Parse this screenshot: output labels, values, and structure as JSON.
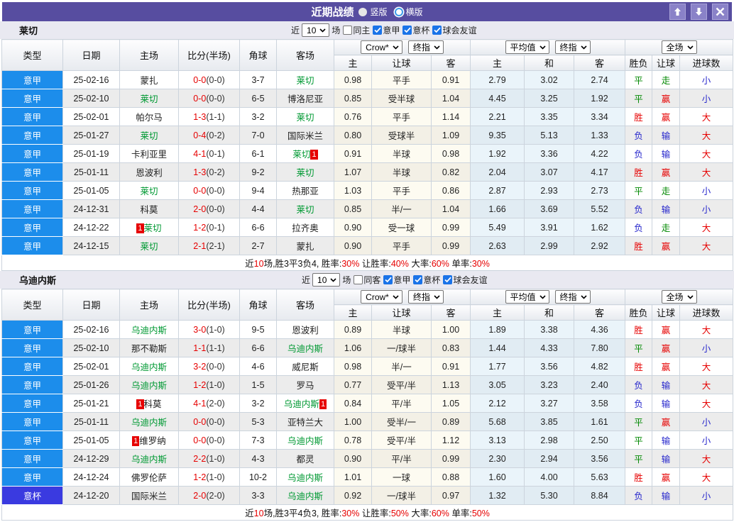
{
  "title_bar": {
    "title": "近期战绩",
    "radio_vertical": "竖版",
    "radio_horizontal": "横版"
  },
  "controls": {
    "near": "近",
    "games": "10",
    "games_suffix": "场",
    "leagues": [
      "意甲",
      "意杯",
      "球会友谊"
    ]
  },
  "columns": {
    "type": "类型",
    "date": "日期",
    "home": "主场",
    "score": "比分(半场)",
    "corner": "角球",
    "away": "客场",
    "odds_home": "主",
    "odds_handicap": "让球",
    "odds_away": "客",
    "avg_home": "主",
    "avg_draw": "和",
    "avg_away": "客",
    "result": "胜负",
    "handicap_result": "让球",
    "goals": "进球数"
  },
  "dropdowns": {
    "bookmaker": "Crow*",
    "final1": "终指",
    "average": "平均值",
    "final2": "终指",
    "fulltime": "全场"
  },
  "tables": [
    {
      "team": "莱切",
      "same_venue_label": "同主",
      "rows": [
        {
          "league": "意甲",
          "date": "25-02-16",
          "home": "蒙扎",
          "home_rc": "",
          "home_self": false,
          "ft": "0-0",
          "ht": "(0-0)",
          "corner": "3-7",
          "away": "莱切",
          "away_rc": "",
          "away_self": true,
          "odds": [
            "0.98",
            "平手",
            "0.91"
          ],
          "avg": [
            "2.79",
            "3.02",
            "2.74"
          ],
          "results": [
            "平",
            "走",
            "小"
          ]
        },
        {
          "league": "意甲",
          "date": "25-02-10",
          "home": "莱切",
          "home_rc": "",
          "home_self": true,
          "ft": "0-0",
          "ht": "(0-0)",
          "corner": "6-5",
          "away": "博洛尼亚",
          "away_rc": "",
          "away_self": false,
          "odds": [
            "0.85",
            "受半球",
            "1.04"
          ],
          "avg": [
            "4.45",
            "3.25",
            "1.92"
          ],
          "results": [
            "平",
            "赢",
            "小"
          ]
        },
        {
          "league": "意甲",
          "date": "25-02-01",
          "home": "帕尔马",
          "home_rc": "",
          "home_self": false,
          "ft": "1-3",
          "ht": "(1-1)",
          "corner": "3-2",
          "away": "莱切",
          "away_rc": "",
          "away_self": true,
          "odds": [
            "0.76",
            "平手",
            "1.14"
          ],
          "avg": [
            "2.21",
            "3.35",
            "3.34"
          ],
          "results": [
            "胜",
            "赢",
            "大"
          ]
        },
        {
          "league": "意甲",
          "date": "25-01-27",
          "home": "莱切",
          "home_rc": "",
          "home_self": true,
          "ft": "0-4",
          "ht": "(0-2)",
          "corner": "7-0",
          "away": "国际米兰",
          "away_rc": "",
          "away_self": false,
          "odds": [
            "0.80",
            "受球半",
            "1.09"
          ],
          "avg": [
            "9.35",
            "5.13",
            "1.33"
          ],
          "results": [
            "负",
            "输",
            "大"
          ]
        },
        {
          "league": "意甲",
          "date": "25-01-19",
          "home": "卡利亚里",
          "home_rc": "",
          "home_self": false,
          "ft": "4-1",
          "ht": "(0-1)",
          "corner": "6-1",
          "away": "莱切",
          "away_rc": "1",
          "away_self": true,
          "odds": [
            "0.91",
            "半球",
            "0.98"
          ],
          "avg": [
            "1.92",
            "3.36",
            "4.22"
          ],
          "results": [
            "负",
            "输",
            "大"
          ]
        },
        {
          "league": "意甲",
          "date": "25-01-11",
          "home": "恩波利",
          "home_rc": "",
          "home_self": false,
          "ft": "1-3",
          "ht": "(0-2)",
          "corner": "9-2",
          "away": "莱切",
          "away_rc": "",
          "away_self": true,
          "odds": [
            "1.07",
            "半球",
            "0.82"
          ],
          "avg": [
            "2.04",
            "3.07",
            "4.17"
          ],
          "results": [
            "胜",
            "赢",
            "大"
          ]
        },
        {
          "league": "意甲",
          "date": "25-01-05",
          "home": "莱切",
          "home_rc": "",
          "home_self": true,
          "ft": "0-0",
          "ht": "(0-0)",
          "corner": "9-4",
          "away": "热那亚",
          "away_rc": "",
          "away_self": false,
          "odds": [
            "1.03",
            "平手",
            "0.86"
          ],
          "avg": [
            "2.87",
            "2.93",
            "2.73"
          ],
          "results": [
            "平",
            "走",
            "小"
          ]
        },
        {
          "league": "意甲",
          "date": "24-12-31",
          "home": "科莫",
          "home_rc": "",
          "home_self": false,
          "ft": "2-0",
          "ht": "(0-0)",
          "corner": "4-4",
          "away": "莱切",
          "away_rc": "",
          "away_self": true,
          "odds": [
            "0.85",
            "半/一",
            "1.04"
          ],
          "avg": [
            "1.66",
            "3.69",
            "5.52"
          ],
          "results": [
            "负",
            "输",
            "小"
          ]
        },
        {
          "league": "意甲",
          "date": "24-12-22",
          "home": "莱切",
          "home_rc": "1",
          "home_self": true,
          "ft": "1-2",
          "ht": "(0-1)",
          "corner": "6-6",
          "away": "拉齐奥",
          "away_rc": "",
          "away_self": false,
          "odds": [
            "0.90",
            "受一球",
            "0.99"
          ],
          "avg": [
            "5.49",
            "3.91",
            "1.62"
          ],
          "results": [
            "负",
            "走",
            "大"
          ]
        },
        {
          "league": "意甲",
          "date": "24-12-15",
          "home": "莱切",
          "home_rc": "",
          "home_self": true,
          "ft": "2-1",
          "ht": "(2-1)",
          "corner": "2-7",
          "away": "蒙扎",
          "away_rc": "",
          "away_self": false,
          "odds": [
            "0.90",
            "平手",
            "0.99"
          ],
          "avg": [
            "2.63",
            "2.99",
            "2.92"
          ],
          "results": [
            "胜",
            "赢",
            "大"
          ]
        }
      ],
      "footer": {
        "prefix": "近",
        "games": "10",
        "middle": "场,胜3平3负4, ",
        "rates": [
          [
            "胜率:",
            "30%"
          ],
          [
            "让胜率:",
            "40%"
          ],
          [
            "大率:",
            "60%"
          ],
          [
            "单率:",
            "30%"
          ]
        ]
      }
    },
    {
      "team": "乌迪内斯",
      "same_venue_label": "同客",
      "rows": [
        {
          "league": "意甲",
          "date": "25-02-16",
          "home": "乌迪内斯",
          "home_rc": "",
          "home_self": true,
          "ft": "3-0",
          "ht": "(1-0)",
          "corner": "9-5",
          "away": "恩波利",
          "away_rc": "",
          "away_self": false,
          "odds": [
            "0.89",
            "半球",
            "1.00"
          ],
          "avg": [
            "1.89",
            "3.38",
            "4.36"
          ],
          "results": [
            "胜",
            "赢",
            "大"
          ]
        },
        {
          "league": "意甲",
          "date": "25-02-10",
          "home": "那不勒斯",
          "home_rc": "",
          "home_self": false,
          "ft": "1-1",
          "ht": "(1-1)",
          "corner": "6-6",
          "away": "乌迪内斯",
          "away_rc": "",
          "away_self": true,
          "odds": [
            "1.06",
            "一/球半",
            "0.83"
          ],
          "avg": [
            "1.44",
            "4.33",
            "7.80"
          ],
          "results": [
            "平",
            "赢",
            "小"
          ]
        },
        {
          "league": "意甲",
          "date": "25-02-01",
          "home": "乌迪内斯",
          "home_rc": "",
          "home_self": true,
          "ft": "3-2",
          "ht": "(0-0)",
          "corner": "4-6",
          "away": "威尼斯",
          "away_rc": "",
          "away_self": false,
          "odds": [
            "0.98",
            "半/一",
            "0.91"
          ],
          "avg": [
            "1.77",
            "3.56",
            "4.82"
          ],
          "results": [
            "胜",
            "赢",
            "大"
          ]
        },
        {
          "league": "意甲",
          "date": "25-01-26",
          "home": "乌迪内斯",
          "home_rc": "",
          "home_self": true,
          "ft": "1-2",
          "ht": "(1-0)",
          "corner": "1-5",
          "away": "罗马",
          "away_rc": "",
          "away_self": false,
          "odds": [
            "0.77",
            "受平/半",
            "1.13"
          ],
          "avg": [
            "3.05",
            "3.23",
            "2.40"
          ],
          "results": [
            "负",
            "输",
            "大"
          ]
        },
        {
          "league": "意甲",
          "date": "25-01-21",
          "home": "科莫",
          "home_rc": "1",
          "home_self": false,
          "ft": "4-1",
          "ht": "(2-0)",
          "corner": "3-2",
          "away": "乌迪内斯",
          "away_rc": "1",
          "away_self": true,
          "odds": [
            "0.84",
            "平/半",
            "1.05"
          ],
          "avg": [
            "2.12",
            "3.27",
            "3.58"
          ],
          "results": [
            "负",
            "输",
            "大"
          ]
        },
        {
          "league": "意甲",
          "date": "25-01-11",
          "home": "乌迪内斯",
          "home_rc": "",
          "home_self": true,
          "ft": "0-0",
          "ht": "(0-0)",
          "corner": "5-3",
          "away": "亚特兰大",
          "away_rc": "",
          "away_self": false,
          "odds": [
            "1.00",
            "受半/一",
            "0.89"
          ],
          "avg": [
            "5.68",
            "3.85",
            "1.61"
          ],
          "results": [
            "平",
            "赢",
            "小"
          ]
        },
        {
          "league": "意甲",
          "date": "25-01-05",
          "home": "维罗纳",
          "home_rc": "1",
          "home_self": false,
          "ft": "0-0",
          "ht": "(0-0)",
          "corner": "7-3",
          "away": "乌迪内斯",
          "away_rc": "",
          "away_self": true,
          "odds": [
            "0.78",
            "受平/半",
            "1.12"
          ],
          "avg": [
            "3.13",
            "2.98",
            "2.50"
          ],
          "results": [
            "平",
            "输",
            "小"
          ]
        },
        {
          "league": "意甲",
          "date": "24-12-29",
          "home": "乌迪内斯",
          "home_rc": "",
          "home_self": true,
          "ft": "2-2",
          "ht": "(1-0)",
          "corner": "4-3",
          "away": "都灵",
          "away_rc": "",
          "away_self": false,
          "odds": [
            "0.90",
            "平/半",
            "0.99"
          ],
          "avg": [
            "2.30",
            "2.94",
            "3.56"
          ],
          "results": [
            "平",
            "输",
            "大"
          ]
        },
        {
          "league": "意甲",
          "date": "24-12-24",
          "home": "佛罗伦萨",
          "home_rc": "",
          "home_self": false,
          "ft": "1-2",
          "ht": "(1-0)",
          "corner": "10-2",
          "away": "乌迪内斯",
          "away_rc": "",
          "away_self": true,
          "odds": [
            "1.01",
            "一球",
            "0.88"
          ],
          "avg": [
            "1.60",
            "4.00",
            "5.63"
          ],
          "results": [
            "胜",
            "赢",
            "大"
          ]
        },
        {
          "league": "意杯",
          "date": "24-12-20",
          "home": "国际米兰",
          "home_rc": "",
          "home_self": false,
          "ft": "2-0",
          "ht": "(2-0)",
          "corner": "3-3",
          "away": "乌迪内斯",
          "away_rc": "",
          "away_self": true,
          "odds": [
            "0.92",
            "一/球半",
            "0.97"
          ],
          "avg": [
            "1.32",
            "5.30",
            "8.84"
          ],
          "results": [
            "负",
            "输",
            "小"
          ]
        }
      ],
      "footer": {
        "prefix": "近",
        "games": "10",
        "middle": "场,胜3平4负3, ",
        "rates": [
          [
            "胜率:",
            "30%"
          ],
          [
            "让胜率:",
            "50%"
          ],
          [
            "大率:",
            "60%"
          ],
          [
            "单率:",
            "50%"
          ]
        ]
      }
    }
  ]
}
